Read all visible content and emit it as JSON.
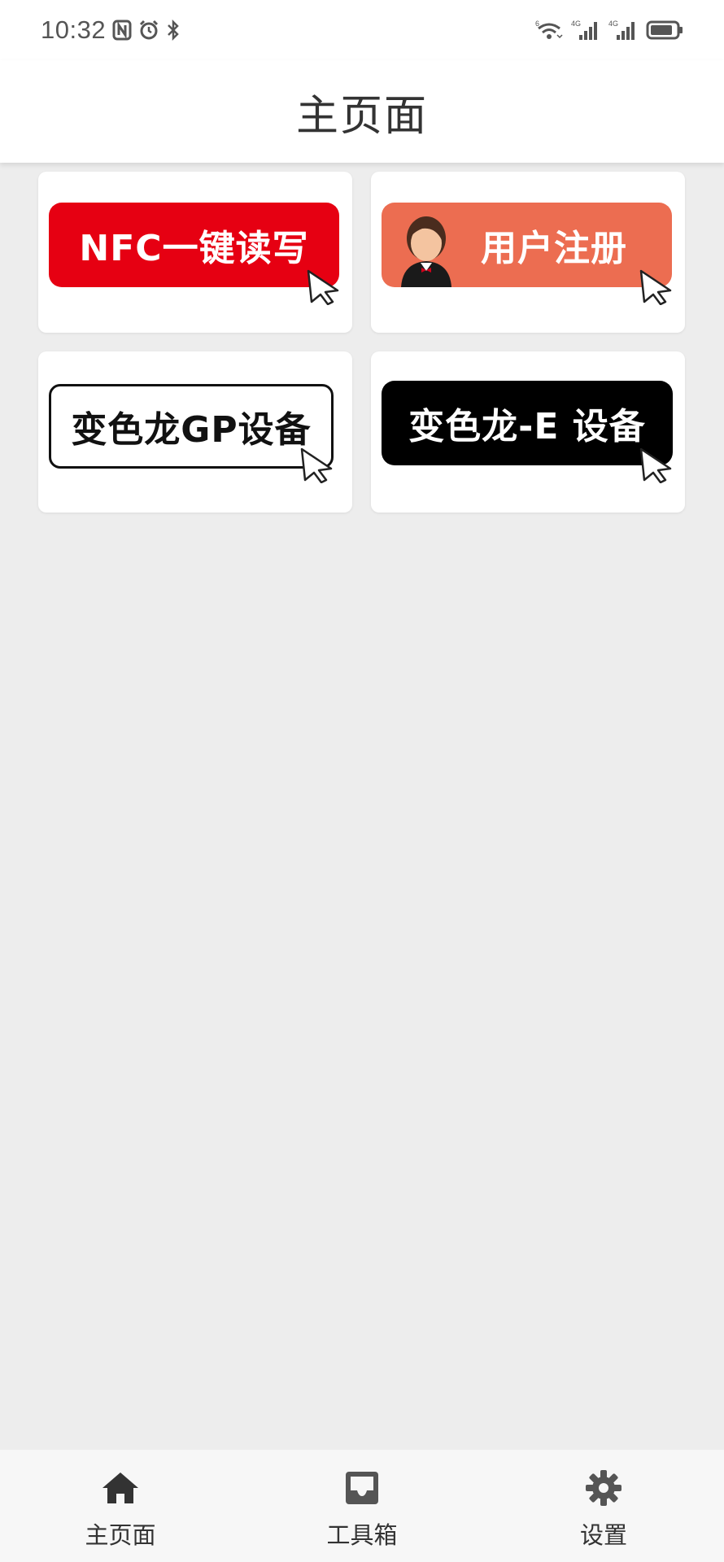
{
  "status_bar": {
    "time": "10:32",
    "left_icons": [
      "nfc-icon",
      "alarm-icon",
      "bluetooth-icon"
    ],
    "right_icons": [
      "wifi-icon",
      "signal-4g-icon",
      "signal-4g-icon",
      "battery-icon"
    ],
    "wifi_label": "6",
    "signal1_label": "4G",
    "signal2_label": "4G"
  },
  "app_bar": {
    "title": "主页面"
  },
  "cards": [
    {
      "label": "NFC一键读写",
      "style": "red",
      "color": "#e60012"
    },
    {
      "label": "用户注册",
      "style": "orange",
      "color": "#ec6d51",
      "icon": "user-avatar-icon"
    },
    {
      "label": "变色龙GP设备",
      "style": "outline",
      "color": "#ffffff"
    },
    {
      "label": "变色龙-E 设备",
      "style": "black",
      "color": "#000000"
    }
  ],
  "bottom_nav": {
    "items": [
      {
        "label": "主页面",
        "icon": "home-icon",
        "active": true
      },
      {
        "label": "工具箱",
        "icon": "inbox-icon",
        "active": false
      },
      {
        "label": "设置",
        "icon": "gear-icon",
        "active": false
      }
    ]
  }
}
